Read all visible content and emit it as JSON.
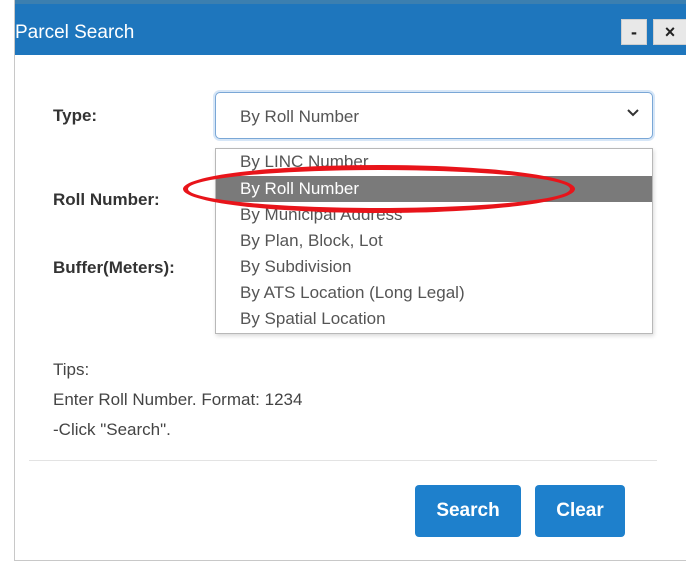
{
  "window": {
    "title": "Parcel Search",
    "minimize_label": "-",
    "close_label": "×"
  },
  "form": {
    "type_label": "Type:",
    "roll_label": "Roll Number:",
    "buffer_label": "Buffer(Meters):",
    "type_select": {
      "value": "By Roll Number",
      "icon": "chevron-down-icon"
    }
  },
  "dropdown": {
    "options": [
      "By LINC Number",
      "By Roll Number",
      "By Municipal Address",
      "By Plan, Block, Lot",
      "By Subdivision",
      "By ATS Location (Long Legal)",
      "By Spatial Location"
    ],
    "selected": "By Roll Number"
  },
  "tips": {
    "heading": "Tips:",
    "line1": "Enter Roll Number. Format: 1234",
    "line2": "-Click \"Search\"."
  },
  "buttons": {
    "search": "Search",
    "clear": "Clear"
  },
  "colors": {
    "titlebar": "#1e76bd",
    "button": "#1e80cc",
    "selected_option": "#7a7a7a",
    "annotation_ring": "#e8141a"
  }
}
